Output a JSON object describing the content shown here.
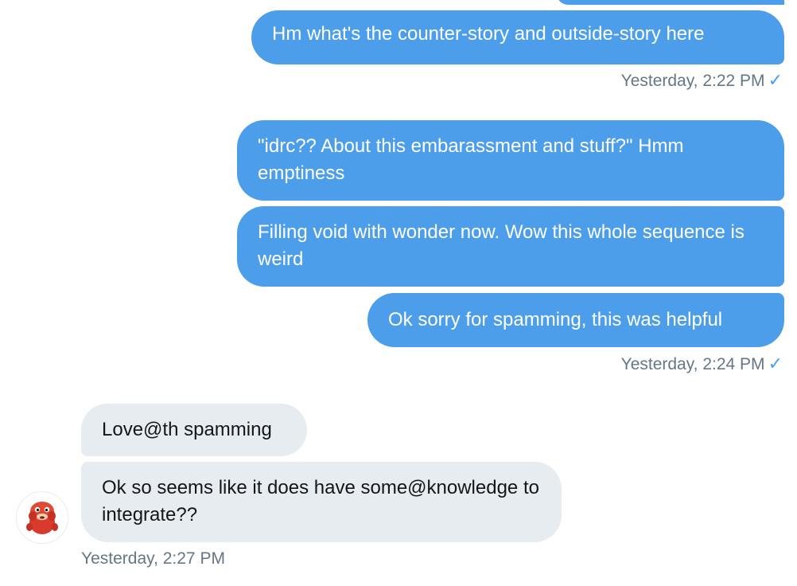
{
  "messages": [
    {
      "direction": "out",
      "text": "Hm what's the counter-story and outside-story here"
    },
    {
      "direction": "out",
      "text": "\"idrc?? About this embarassment and stuff?\" Hmm emptiness"
    },
    {
      "direction": "out",
      "text": "Filling void with wonder now. Wow this whole sequence is weird"
    },
    {
      "direction": "out",
      "text": "Ok sorry for spamming, this was helpful"
    },
    {
      "direction": "in",
      "text": "Love@th spamming"
    },
    {
      "direction": "in",
      "text": "Ok so seems like it does have some@knowledge to integrate??"
    }
  ],
  "timestamps": [
    {
      "text": "Yesterday, 2:22 PM",
      "read_check": "✓"
    },
    {
      "text": "Yesterday, 2:24 PM",
      "read_check": "✓"
    },
    {
      "text": "Yesterday, 2:27 PM"
    }
  ],
  "avatar": {
    "icon": "red-creature-avatar-icon"
  },
  "colors": {
    "outgoing": "#4c9eeb",
    "incoming": "#e6ecf0",
    "timestamp": "#657786"
  }
}
